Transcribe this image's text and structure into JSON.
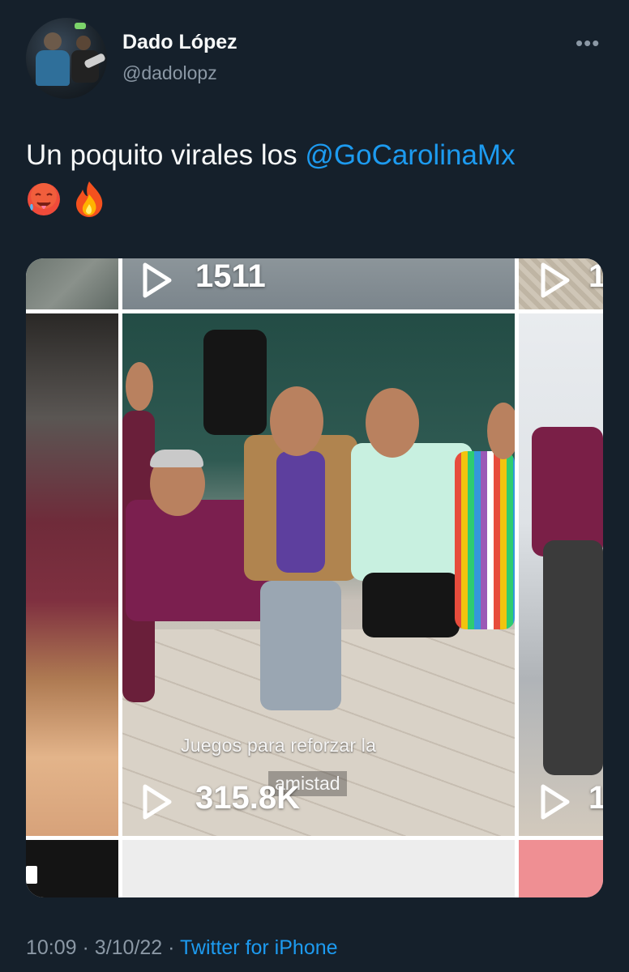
{
  "author": {
    "name": "Dado López",
    "handle": "@dadolopz"
  },
  "menu_icon": "more-options-icon",
  "tweet": {
    "text_prefix": "Un poquito virales los ",
    "mention": "@GoCarolinaMx",
    "emojis": [
      "hot-face-emoji",
      "fire-emoji"
    ]
  },
  "media": {
    "top_view_count": "1511",
    "right_top_partial": "1",
    "main_view_count": "315.8K",
    "right_mid_partial": "1",
    "caption_line1": "Juegos para reforzar la",
    "caption_line2": "amistad"
  },
  "footer": {
    "time": "10:09",
    "date": "3/10/22",
    "source": "Twitter for iPhone"
  },
  "colors": {
    "background": "#15202b",
    "text": "#f7f9f9",
    "secondary": "#8b98a5",
    "accent": "#1d9bf0"
  }
}
